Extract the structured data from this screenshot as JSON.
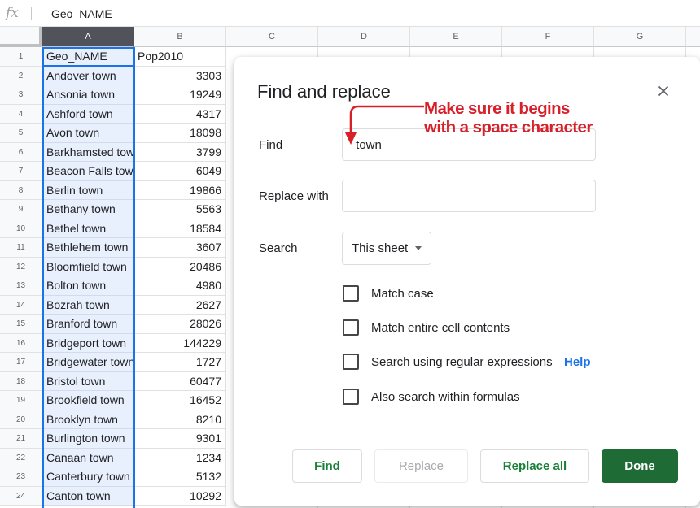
{
  "formula_bar": {
    "fx_label": "fx",
    "value": "Geo_NAME"
  },
  "columns": [
    "A",
    "B",
    "C",
    "D",
    "E",
    "F",
    "G"
  ],
  "rows": [
    {
      "n": "1",
      "a": "Geo_NAME",
      "b": "Pop2010"
    },
    {
      "n": "2",
      "a": "Andover town",
      "b": "3303"
    },
    {
      "n": "3",
      "a": "Ansonia town",
      "b": "19249"
    },
    {
      "n": "4",
      "a": "Ashford town",
      "b": "4317"
    },
    {
      "n": "5",
      "a": "Avon town",
      "b": "18098"
    },
    {
      "n": "6",
      "a": "Barkhamsted town",
      "b": "3799"
    },
    {
      "n": "7",
      "a": "Beacon Falls town",
      "b": "6049"
    },
    {
      "n": "8",
      "a": "Berlin town",
      "b": "19866"
    },
    {
      "n": "9",
      "a": "Bethany town",
      "b": "5563"
    },
    {
      "n": "10",
      "a": "Bethel town",
      "b": "18584"
    },
    {
      "n": "11",
      "a": "Bethlehem town",
      "b": "3607"
    },
    {
      "n": "12",
      "a": "Bloomfield town",
      "b": "20486"
    },
    {
      "n": "13",
      "a": "Bolton town",
      "b": "4980"
    },
    {
      "n": "14",
      "a": "Bozrah town",
      "b": "2627"
    },
    {
      "n": "15",
      "a": "Branford town",
      "b": "28026"
    },
    {
      "n": "16",
      "a": "Bridgeport town",
      "b": "144229"
    },
    {
      "n": "17",
      "a": "Bridgewater town",
      "b": "1727"
    },
    {
      "n": "18",
      "a": "Bristol town",
      "b": "60477"
    },
    {
      "n": "19",
      "a": "Brookfield town",
      "b": "16452"
    },
    {
      "n": "20",
      "a": "Brooklyn town",
      "b": "8210"
    },
    {
      "n": "21",
      "a": "Burlington town",
      "b": "9301"
    },
    {
      "n": "22",
      "a": "Canaan town",
      "b": "1234"
    },
    {
      "n": "23",
      "a": "Canterbury town",
      "b": "5132"
    },
    {
      "n": "24",
      "a": "Canton town",
      "b": "10292"
    }
  ],
  "dialog": {
    "title": "Find and replace",
    "find_label": "Find",
    "find_value": " town",
    "replace_label": "Replace with",
    "replace_value": "",
    "search_label": "Search",
    "search_scope": "This sheet",
    "options": {
      "match_case": "Match case",
      "match_entire": "Match entire cell contents",
      "regex": "Search using regular expressions",
      "help": "Help",
      "formulas": "Also search within formulas"
    },
    "buttons": {
      "find": "Find",
      "replace": "Replace",
      "replace_all": "Replace all",
      "done": "Done"
    }
  },
  "annotation": {
    "line1": "Make sure it begins",
    "line2": "with a space character",
    "color": "#d8202a"
  },
  "colors": {
    "selection": "#1a73e8",
    "done_button": "#1e6b35",
    "action_text": "#188038"
  }
}
